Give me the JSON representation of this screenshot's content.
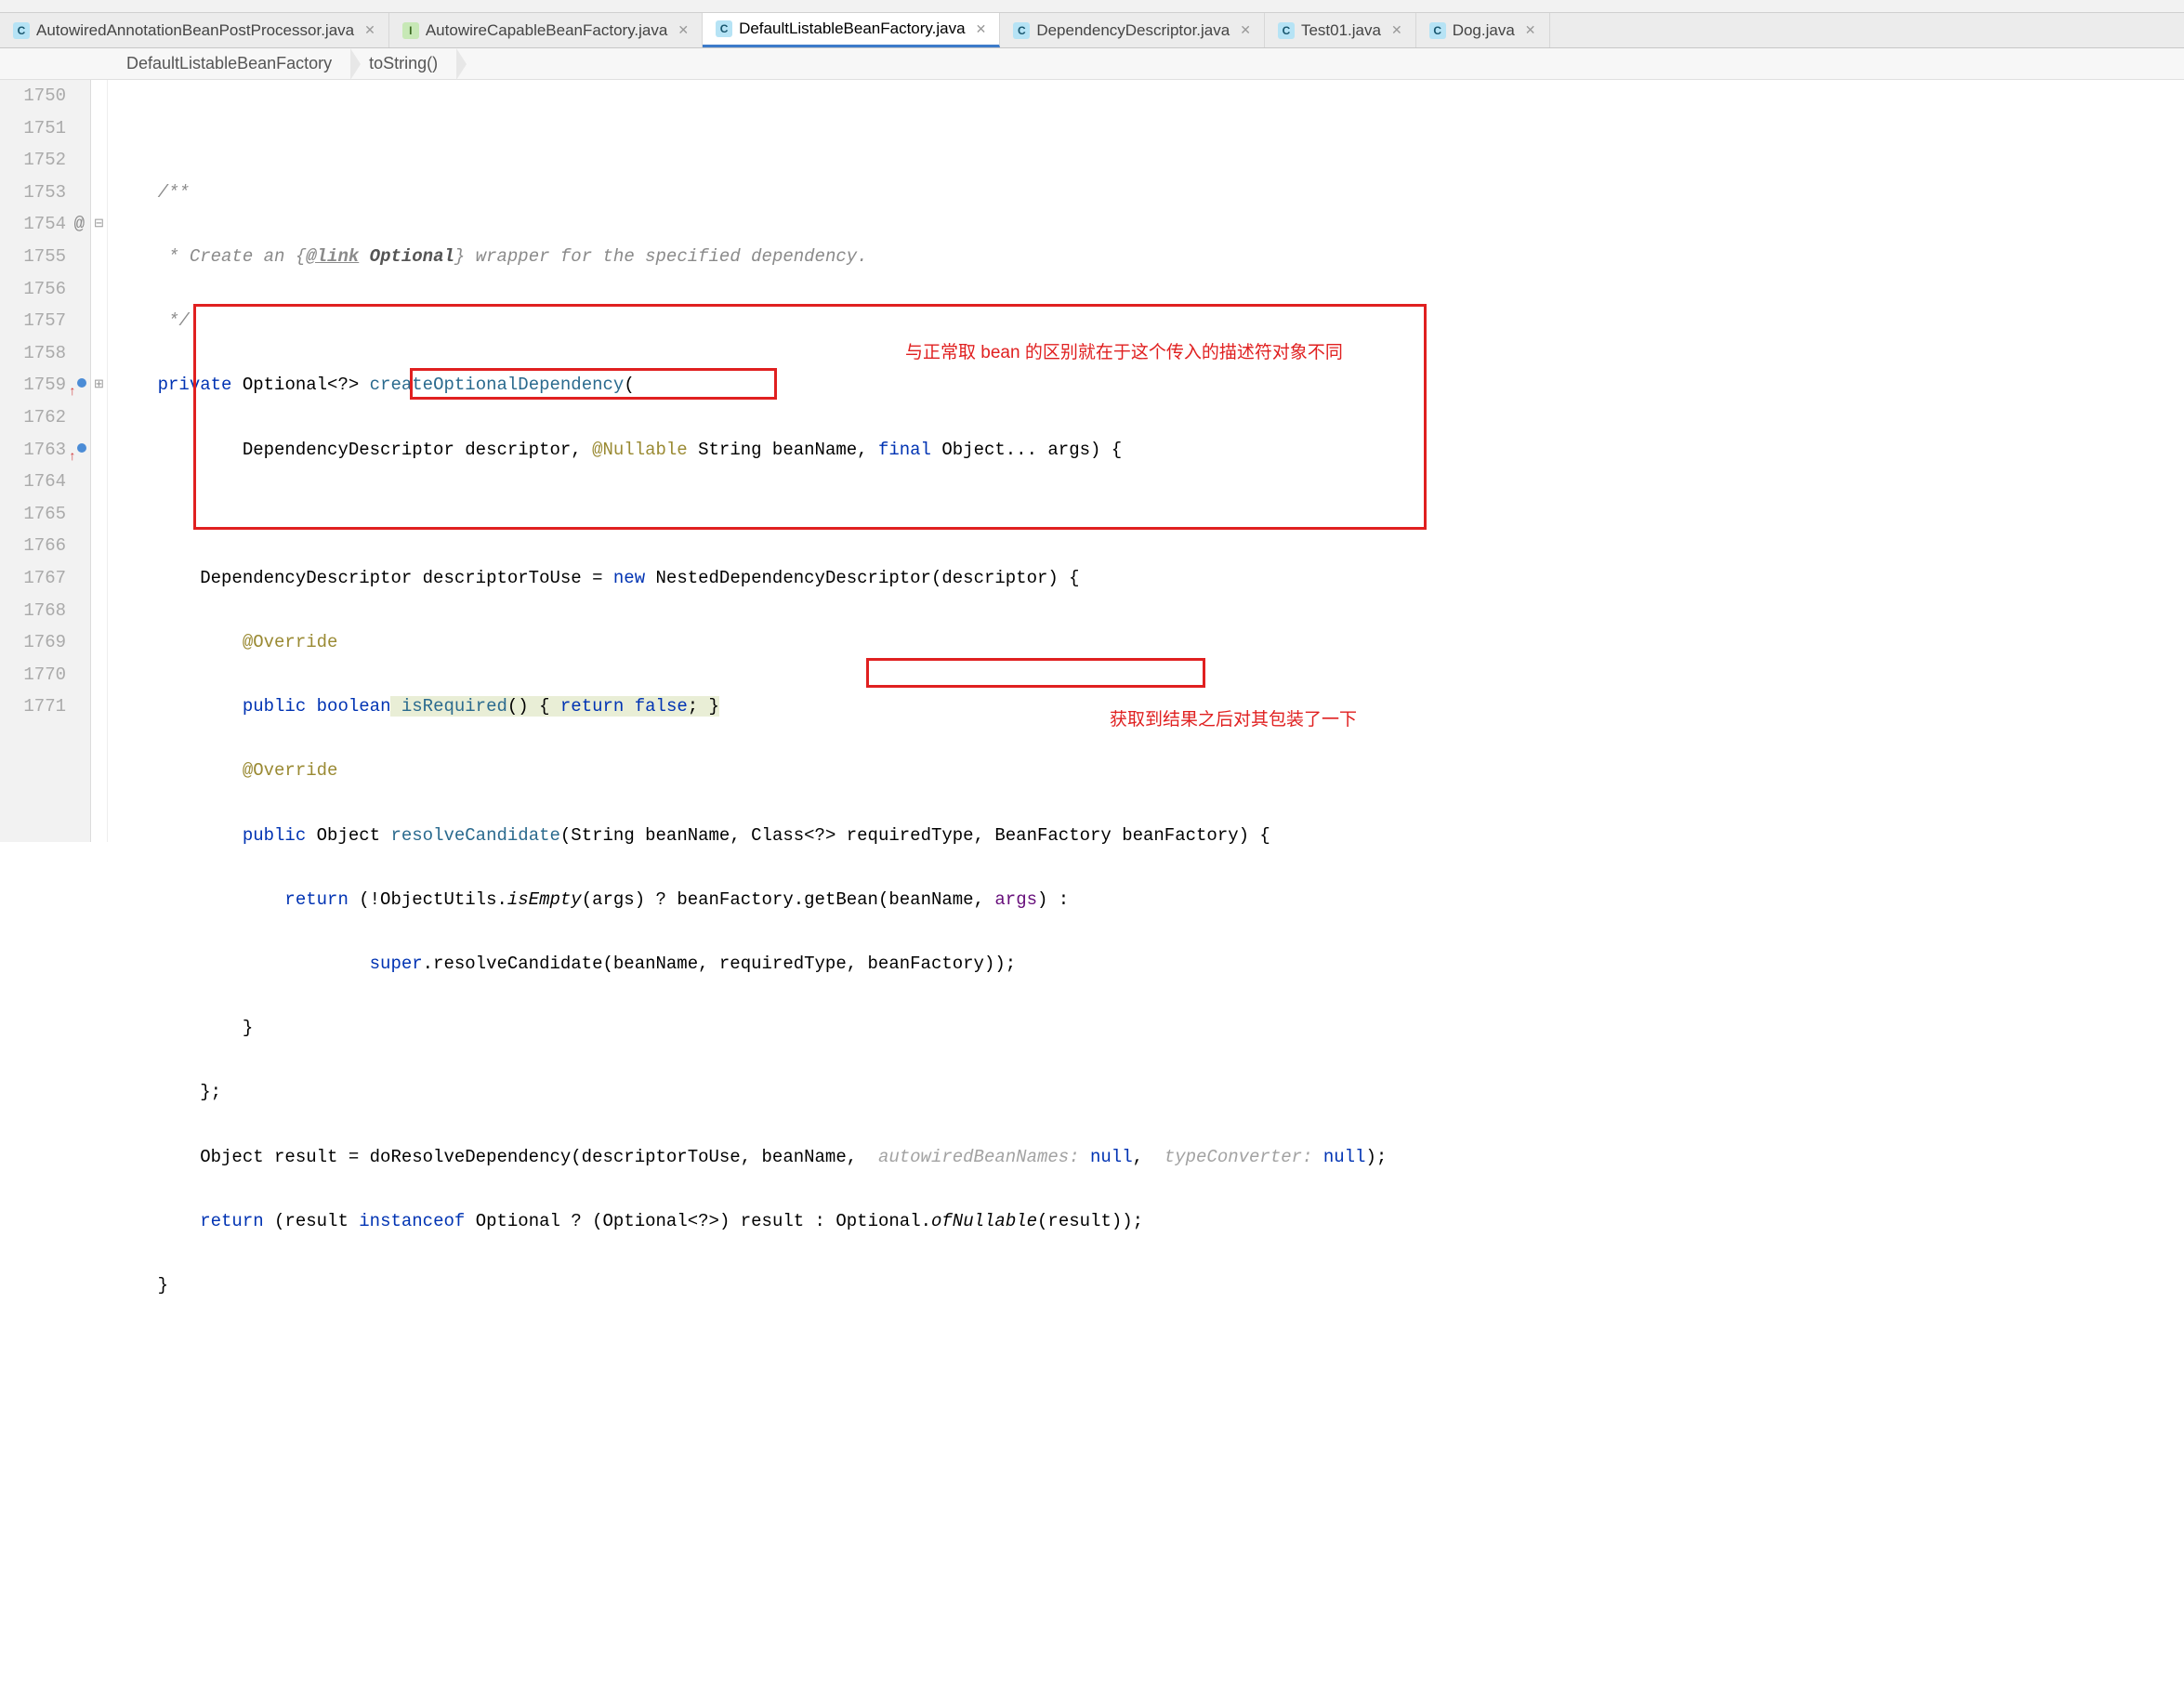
{
  "breadcrumb": {
    "top_hint": ""
  },
  "tabs": [
    {
      "icon": "c",
      "label": "AutowiredAnnotationBeanPostProcessor.java",
      "active": false
    },
    {
      "icon": "i",
      "label": "AutowireCapableBeanFactory.java",
      "active": false
    },
    {
      "icon": "c",
      "label": "DefaultListableBeanFactory.java",
      "active": true
    },
    {
      "icon": "c",
      "label": "DependencyDescriptor.java",
      "active": false
    },
    {
      "icon": "c",
      "label": "Test01.java",
      "active": false
    },
    {
      "icon": "c",
      "label": "Dog.java",
      "active": false
    }
  ],
  "crumbs": [
    {
      "label": "DefaultListableBeanFactory"
    },
    {
      "label": "toString()"
    }
  ],
  "gutter": {
    "lines": [
      "1750",
      "1751",
      "1752",
      "1753",
      "1754",
      "1755",
      "1756",
      "1757",
      "1758",
      "1759",
      "1762",
      "1763",
      "1764",
      "1765",
      "1766",
      "1767",
      "1768",
      "1769",
      "1770",
      "1771"
    ],
    "override_at": "1754",
    "marks": [
      "1759",
      "1763"
    ]
  },
  "code": {
    "l1750": "",
    "l1751_doc_open": "/**",
    "l1752_doc_pre": " * Create an {",
    "l1752_dockw": "@link",
    "l1752_docbold": " Optional",
    "l1752_doc_post": "} wrapper for the specified dependency.",
    "l1753_doc_close": " */",
    "l1754_kw1": "private",
    "l1754_type": " Optional<?> ",
    "l1754_meth": "createOptionalDependency",
    "l1754_tail": "(",
    "l1755_pre": "        DependencyDescriptor descriptor, ",
    "l1755_ann": "@Nullable",
    "l1755_mid": " String beanName, ",
    "l1755_kw": "final",
    "l1755_tail": " Object... args) {",
    "l1756": "",
    "l1757_pre": "    DependencyDescriptor descriptorToUse = ",
    "l1757_kw": "new",
    "l1757_tail": " NestedDependencyDescriptor(descriptor) {",
    "l1758_ann": "        @Override",
    "l1759_kw1": "        public",
    "l1759_kw2": " boolean",
    "l1759_meth": " isRequired",
    "l1759_body_kw": "return",
    "l1759_body_kw2": "false",
    "l1762_ann": "        @Override",
    "l1763_kw1": "        public",
    "l1763_type": " Object ",
    "l1763_meth": "resolveCandidate",
    "l1763_tail": "(String beanName, Class<?> requiredType, BeanFactory beanFactory) {",
    "l1764_kw": "            return",
    "l1764_pre": " (!ObjectUtils.",
    "l1764_it": "isEmpty",
    "l1764_mid": "(args) ? beanFactory.getBean(beanName, ",
    "l1764_id": "args",
    "l1764_tail": ") :",
    "l1765_kw": "                    super",
    "l1765_tail": ".resolveCandidate(beanName, requiredType, beanFactory));",
    "l1766": "        }",
    "l1767": "    };",
    "l1768_pre": "    Object result = doResolveDependency(descriptorToUse, beanName,  ",
    "l1768_hint1": "autowiredBeanNames: ",
    "l1768_kw1": "null",
    "l1768_mid": ",  ",
    "l1768_hint2": "typeConverter: ",
    "l1768_kw2": "null",
    "l1768_tail": ");",
    "l1769_kw1": "    return",
    "l1769_mid1": " (result ",
    "l1769_kw2": "instanceof",
    "l1769_mid2": " Optional ? (Optional<?>) result : ",
    "l1769_box": "Optional.",
    "l1769_it": "ofNullable",
    "l1769_tail": "(result));",
    "l1770": "}",
    "l1771": ""
  },
  "annotations": {
    "note1": "与正常取 bean 的区别就在于这个传入的描述符对象不同",
    "note2": "获取到结果之后对其包装了一下"
  }
}
